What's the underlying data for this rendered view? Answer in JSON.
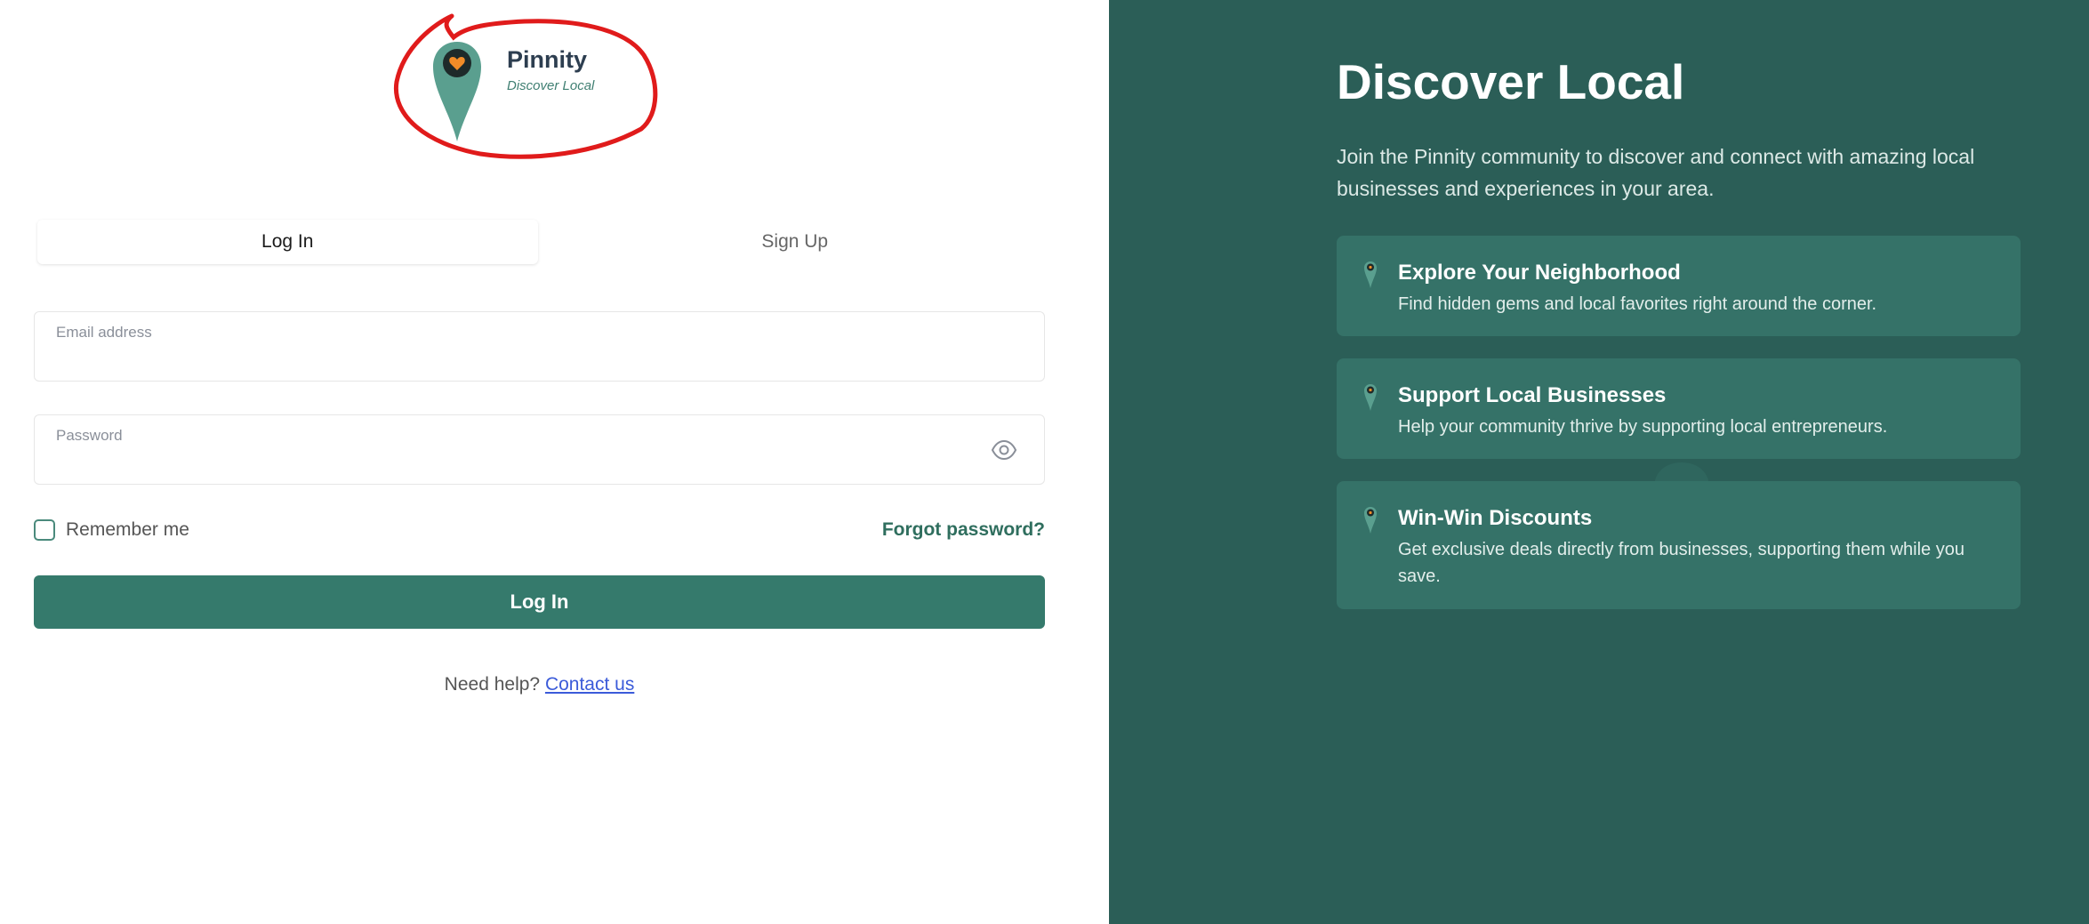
{
  "brand": {
    "name": "Pinnity",
    "tagline": "Discover Local"
  },
  "tabs": [
    {
      "label": "Log In",
      "active": true
    },
    {
      "label": "Sign Up",
      "active": false
    }
  ],
  "form": {
    "email_label": "Email address",
    "email_value": "",
    "password_label": "Password",
    "password_value": "",
    "remember_label": "Remember me",
    "remember_checked": false,
    "forgot_label": "Forgot password?",
    "submit_label": "Log In"
  },
  "help": {
    "prefix": "Need help?",
    "link": "Contact us"
  },
  "hero": {
    "title": "Discover Local",
    "description": "Join the Pinnity community to discover and connect with amazing local businesses and experiences in your area."
  },
  "features": [
    {
      "title": "Explore Your Neighborhood",
      "description": "Find hidden gems and local favorites right around the corner.",
      "icon": "map-pin-icon"
    },
    {
      "title": "Support Local Businesses",
      "description": "Help your community thrive by supporting local entrepreneurs.",
      "icon": "map-pin-icon"
    },
    {
      "title": "Win-Win Discounts",
      "description": "Get exclusive deals directly from businesses, supporting them while you save.",
      "icon": "map-pin-icon"
    }
  ],
  "colors": {
    "primary": "#357a6c",
    "right_panel_bg": "#2b5e57",
    "card_bg": "#357268",
    "annotation": "#e01b1b",
    "pin_accent": "#f28c28"
  }
}
